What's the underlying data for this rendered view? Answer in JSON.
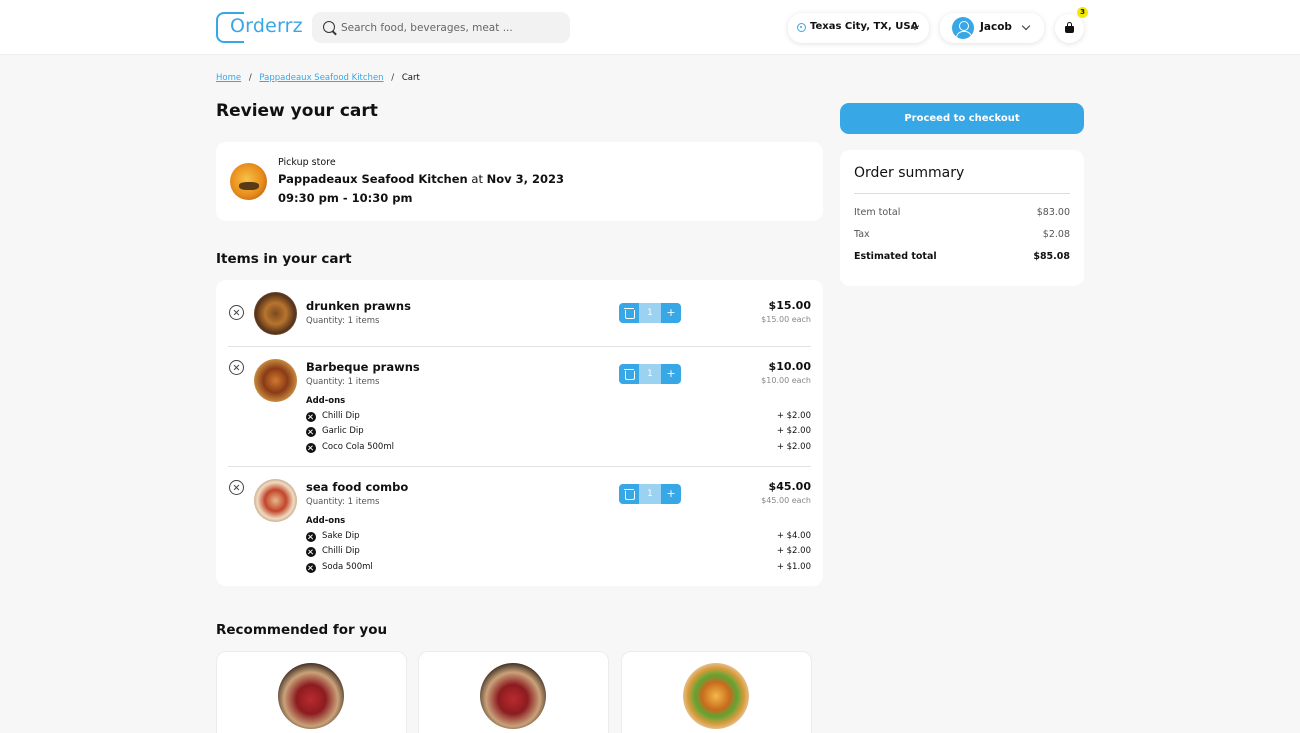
{
  "colors": {
    "accent": "#38a7e6",
    "badge": "#f5e800",
    "background": "#f7f7f7"
  },
  "header": {
    "logo": "Orderrz",
    "search_placeholder": "Search food, beverages, meat ...",
    "location": "Texas City, TX, USA",
    "user": "Jacob",
    "cart_count": "3"
  },
  "breadcrumb": {
    "home": "Home",
    "store": "Pappadeaux Seafood Kitchen",
    "current": "Cart",
    "separator": "/"
  },
  "page_title": "Review your cart",
  "pickup": {
    "label": "Pickup store",
    "store": "Pappadeaux Seafood Kitchen",
    "at": "at",
    "date": "Nov 3, 2023",
    "time": "09:30 pm - 10:30 pm"
  },
  "items_title": "Items in your cart",
  "items": [
    {
      "name": "drunken prawns",
      "quantity_text": "Quantity: 1 items",
      "qty": "1",
      "price": "$15.00",
      "each": "$15.00 each",
      "addons_label": "",
      "addons": []
    },
    {
      "name": "Barbeque prawns",
      "quantity_text": "Quantity: 1 items",
      "qty": "1",
      "price": "$10.00",
      "each": "$10.00 each",
      "addons_label": "Add-ons",
      "addons": [
        {
          "name": "Chilli Dip",
          "price": "+ $2.00"
        },
        {
          "name": "Garlic Dip",
          "price": "+ $2.00"
        },
        {
          "name": "Coco Cola 500ml",
          "price": "+ $2.00"
        }
      ]
    },
    {
      "name": "sea food combo",
      "quantity_text": "Quantity: 1 items",
      "qty": "1",
      "price": "$45.00",
      "each": "$45.00 each",
      "addons_label": "Add-ons",
      "addons": [
        {
          "name": "Sake Dip",
          "price": "+ $4.00"
        },
        {
          "name": "Chilli Dip",
          "price": "+ $2.00"
        },
        {
          "name": "Soda 500ml",
          "price": "+ $1.00"
        }
      ]
    }
  ],
  "stepper": {
    "plus": "+"
  },
  "checkout_button": "Proceed to checkout",
  "summary": {
    "title": "Order summary",
    "item_total_label": "Item total",
    "item_total": "$83.00",
    "tax_label": "Tax",
    "tax": "$2.08",
    "estimated_label": "Estimated total",
    "estimated": "$85.08"
  },
  "recommended_title": "Recommended for you",
  "recommended": [
    {
      "icon": "meat-image"
    },
    {
      "icon": "meat-image"
    },
    {
      "icon": "burger-image"
    }
  ]
}
